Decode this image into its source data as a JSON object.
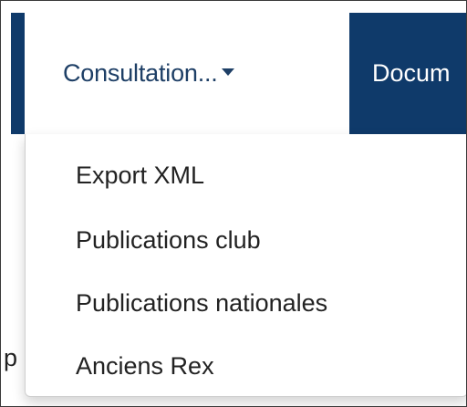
{
  "navbar": {
    "active_tab_label": "Consultation...",
    "next_tab_label": "Docum"
  },
  "edge_text": "p",
  "dropdown": {
    "items": [
      {
        "label": "Export XML"
      },
      {
        "label": "Publications club"
      },
      {
        "label": "Publications nationales"
      },
      {
        "label": "Anciens Rex"
      }
    ]
  },
  "colors": {
    "navbar_bg": "#0f3a6a",
    "active_text": "#1e3f66",
    "menu_text": "#222222"
  }
}
